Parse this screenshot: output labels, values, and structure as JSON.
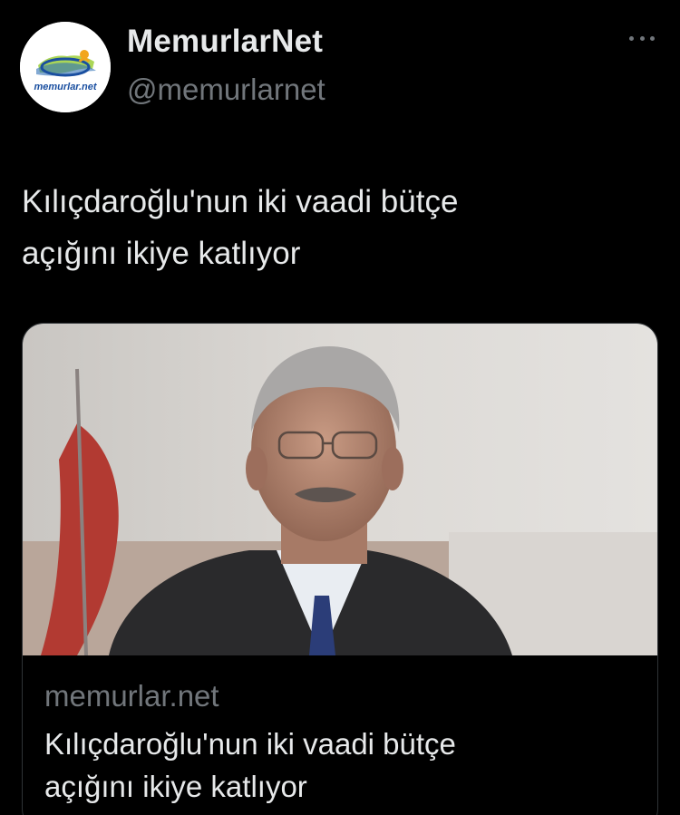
{
  "account": {
    "display_name": "MemurlarNet",
    "handle": "@memurlarnet",
    "avatar_logo_text": "memurlar.net"
  },
  "tweet": {
    "text_line1": "Kılıçdaroğlu'nun iki vaadi bütçe",
    "text_line2": "açığını ikiye katlıyor"
  },
  "card": {
    "domain": "memurlar.net",
    "title_line1": "Kılıçdaroğlu'nun iki vaadi bütçe",
    "title_line2": "açığını ikiye katlıyor"
  },
  "icons": {
    "more": "more-horizontal-icon"
  },
  "colors": {
    "background": "#000000",
    "primary_text": "#e7e9ea",
    "secondary_text": "#71767b",
    "card_border": "#2f3336"
  }
}
